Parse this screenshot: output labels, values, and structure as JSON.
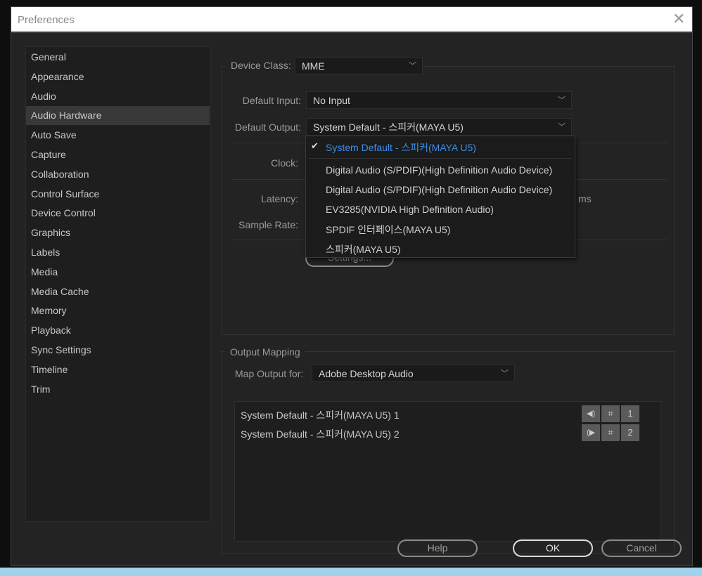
{
  "window": {
    "title": "Preferences",
    "close_icon": "close-icon"
  },
  "sidebar": {
    "selected": "Audio Hardware",
    "items": [
      "General",
      "Appearance",
      "Audio",
      "Audio Hardware",
      "Auto Save",
      "Capture",
      "Collaboration",
      "Control Surface",
      "Device Control",
      "Graphics",
      "Labels",
      "Media",
      "Media Cache",
      "Memory",
      "Playback",
      "Sync Settings",
      "Timeline",
      "Trim"
    ]
  },
  "hardware": {
    "device_class_label": "Device Class:",
    "device_class_value": "MME",
    "default_input_label": "Default Input:",
    "default_input_value": "No Input",
    "default_output_label": "Default Output:",
    "default_output_value": "System Default - 스피커(MAYA U5)",
    "clock_label": "Clock:",
    "latency_label": "Latency:",
    "latency_unit": "ms",
    "sample_rate_label": "Sample Rate:",
    "settings_button": "Settings..."
  },
  "output_dropdown": {
    "selected_index": 0,
    "options": [
      "System Default - 스피커(MAYA U5)",
      "Digital Audio (S/PDIF)(High Definition Audio Device)",
      "Digital Audio (S/PDIF)(High Definition Audio Device)",
      "EV3285(NVIDIA High Definition Audio)",
      "SPDIF 인터페이스(MAYA U5)",
      "스피커(MAYA U5)"
    ],
    "selected_color": "#3d8ee6"
  },
  "output_mapping": {
    "legend": "Output Mapping",
    "map_output_label": "Map Output for:",
    "map_output_value": "Adobe Desktop Audio",
    "channels": [
      {
        "label": "System Default - 스피커(MAYA U5) 1",
        "number": "1",
        "speaker_icon": "speaker-left-icon"
      },
      {
        "label": "System Default - 스피커(MAYA U5) 2",
        "number": "2",
        "speaker_icon": "speaker-right-icon"
      }
    ]
  },
  "buttons": {
    "help": "Help",
    "ok": "OK",
    "cancel": "Cancel"
  }
}
